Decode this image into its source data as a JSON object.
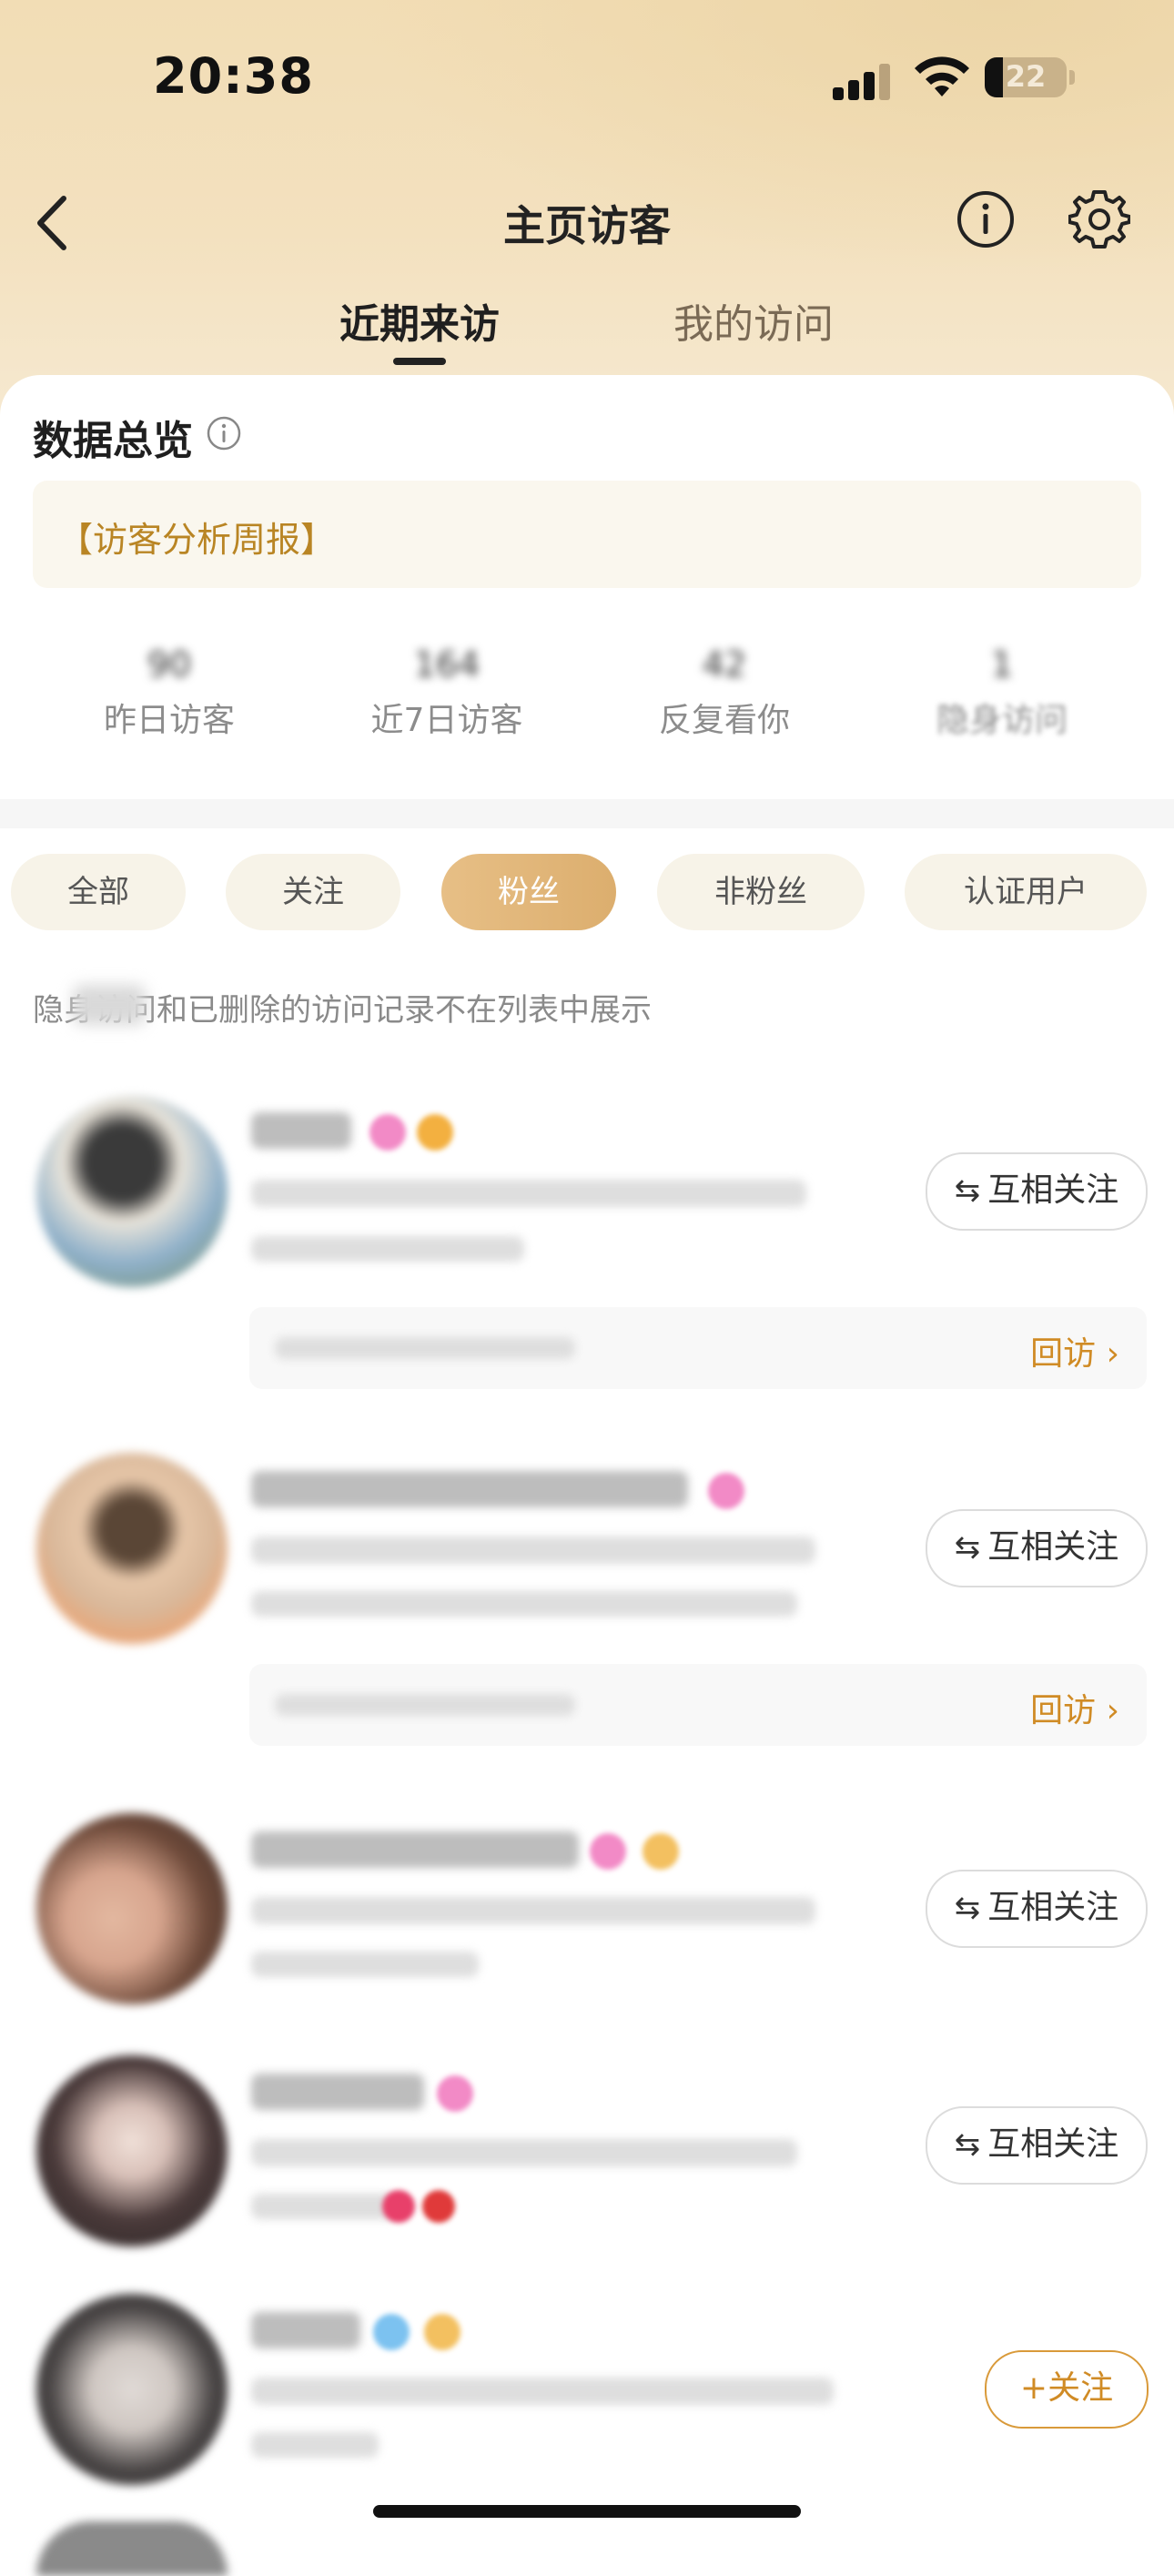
{
  "status_bar": {
    "time": "20:38",
    "battery": "22"
  },
  "nav": {
    "title": "主页访客"
  },
  "tabs": [
    {
      "label": "近期来访",
      "active": true
    },
    {
      "label": "我的访问",
      "active": false
    }
  ],
  "overview": {
    "title": "数据总览",
    "report": "【访客分析周报】",
    "stats": [
      {
        "value": "90",
        "label": "昨日访客"
      },
      {
        "value": "164",
        "label": "近7日访客"
      },
      {
        "value": "42",
        "label": "反复看你"
      },
      {
        "value": "1",
        "label": "隐身访问"
      }
    ]
  },
  "filters": [
    {
      "label": "全部",
      "active": false
    },
    {
      "label": "关注",
      "active": false
    },
    {
      "label": "粉丝",
      "active": true
    },
    {
      "label": "非粉丝",
      "active": false
    },
    {
      "label": "认证用户",
      "active": false
    }
  ],
  "notice": "隐身访问和已删除的访问记录不在列表中展示",
  "visitors": [
    {
      "follow_label": "互相关注",
      "revisit_label": "回访 ›"
    },
    {
      "follow_label": "互相关注",
      "revisit_label": "回访 ›"
    },
    {
      "follow_label": "互相关注"
    },
    {
      "follow_label": "互相关注"
    },
    {
      "follow_label": "+关注"
    }
  ],
  "colors": {
    "accent": "#d08b25",
    "chip_active": "#dcae6e",
    "header_bg": "#f2ddb5"
  }
}
